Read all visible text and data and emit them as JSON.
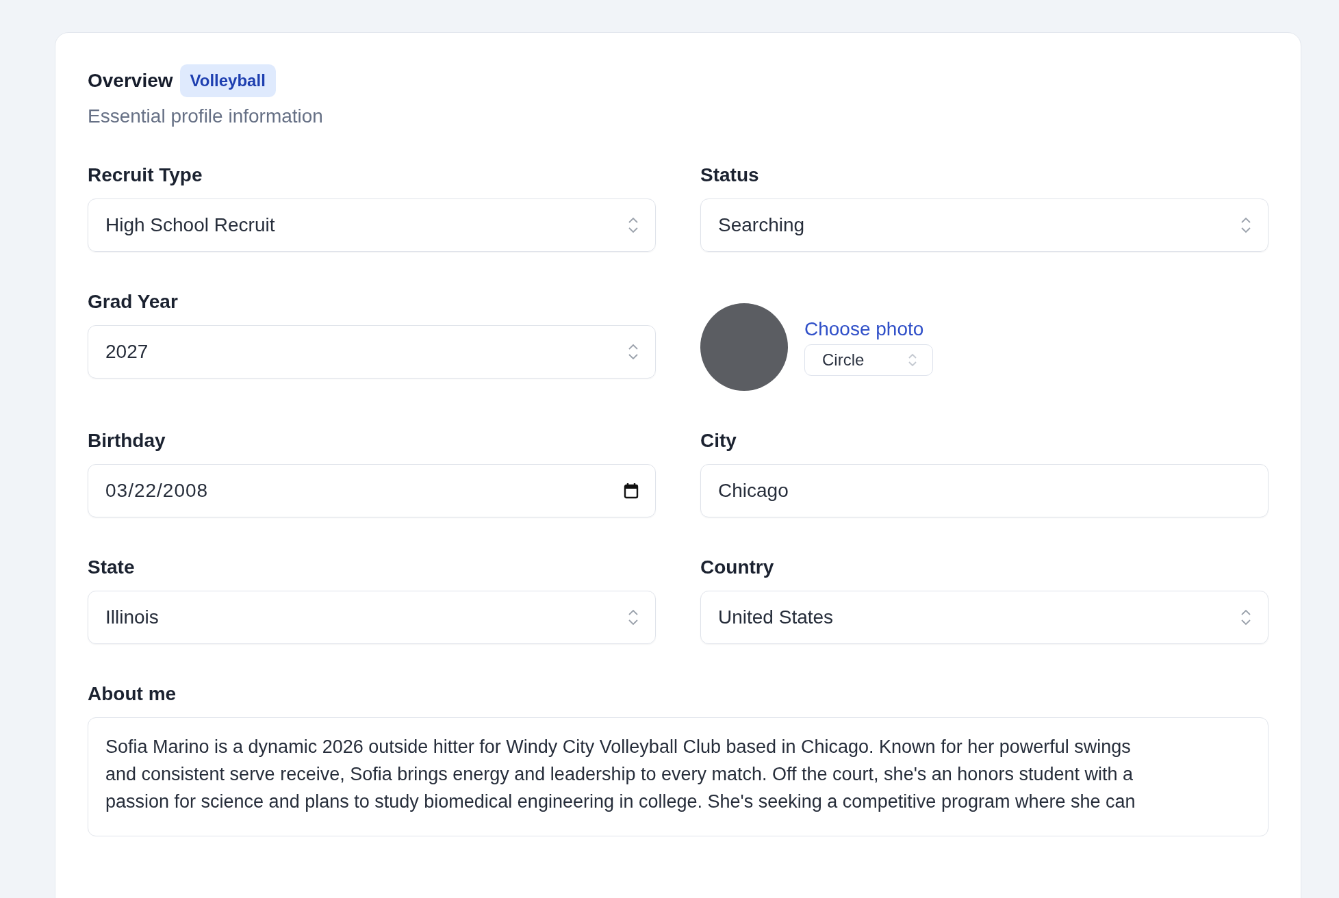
{
  "header": {
    "title": "Overview",
    "badge": "Volleyball",
    "subtitle": "Essential profile information"
  },
  "fields": [
    {
      "label": "Recruit Type",
      "kind": "select",
      "value": "High School Recruit"
    },
    {
      "label": "Status",
      "kind": "select",
      "value": "Searching"
    },
    {
      "label": "Grad Year",
      "kind": "select",
      "value": "2027"
    },
    {
      "kind": "photo",
      "link": "Choose photo",
      "shape": "Circle"
    },
    {
      "label": "Birthday",
      "kind": "date",
      "value": "03/22/2008"
    },
    {
      "label": "City",
      "kind": "text",
      "value": "Chicago"
    },
    {
      "label": "State",
      "kind": "select",
      "value": "Illinois"
    },
    {
      "label": "Country",
      "kind": "select",
      "value": "United States"
    }
  ],
  "about": {
    "label": "About me",
    "value": "Sofia Marino is a dynamic 2026 outside hitter for Windy City Volleyball Club based in Chicago. Known for her powerful swings\nand consistent serve receive, Sofia brings energy and leadership to every match. Off the court, she's an honors student with a\npassion for science and plans to study biomedical engineering in college. She's seeking a competitive program where she can"
  }
}
